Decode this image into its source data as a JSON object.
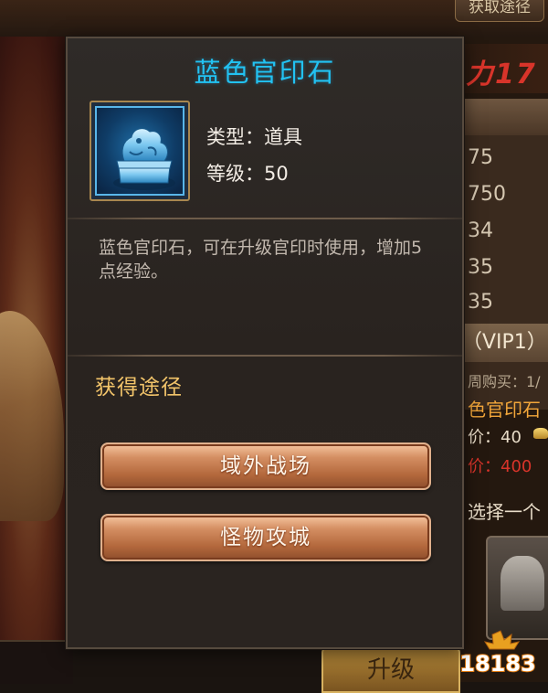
{
  "background": {
    "acquire_tab_label": "获取途径",
    "power_value": "力17",
    "stats": [
      "75",
      "750",
      "34",
      "35",
      "35"
    ],
    "vip_label": "（VIP1）",
    "weekly_label": "周购买：1/",
    "item_name_partial": "色官印石",
    "price_label": "价：40",
    "price_label_2": "价：400",
    "choose_label": "选择一个",
    "upgrade_label": "升级",
    "watermark": "18183"
  },
  "popup": {
    "title": "蓝色官印石",
    "type_label": "类型：道具",
    "level_label": "等级：50",
    "description": "蓝色官印石，可在升级官印时使用，增加5点经验。",
    "source_heading": "获得途径",
    "sources": [
      {
        "label": "域外战场"
      },
      {
        "label": "怪物攻城"
      }
    ]
  },
  "colors": {
    "title": "#22c2f2",
    "heading": "#f2c46a",
    "button_gradient_top": "#f6c6a0",
    "button_gradient_bottom": "#8e4e2c"
  },
  "icons": {
    "item_icon": "blue-seal-icon"
  }
}
